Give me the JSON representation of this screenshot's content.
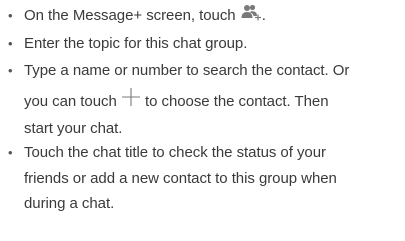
{
  "instructions": {
    "bullet_char": "•",
    "steps": [
      {
        "before_icon": "On the Message+ screen, touch ",
        "icon": "new-group-chat-icon",
        "after_icon": "."
      },
      {
        "text": "Enter the topic for this chat group."
      },
      {
        "line1": "Type a name or number to search the contact. Or",
        "line2_before_icon": "you can touch ",
        "icon": "plus-icon",
        "line2_after_icon": " to choose the contact. Then",
        "line3": "start your chat."
      },
      {
        "line1": "Touch the chat title to check the status of your",
        "line2": "friends or add a new contact to this group when",
        "line3": "during a chat."
      }
    ]
  },
  "colors": {
    "text": "#3a3a3a",
    "icon": "#7a7a7a"
  }
}
